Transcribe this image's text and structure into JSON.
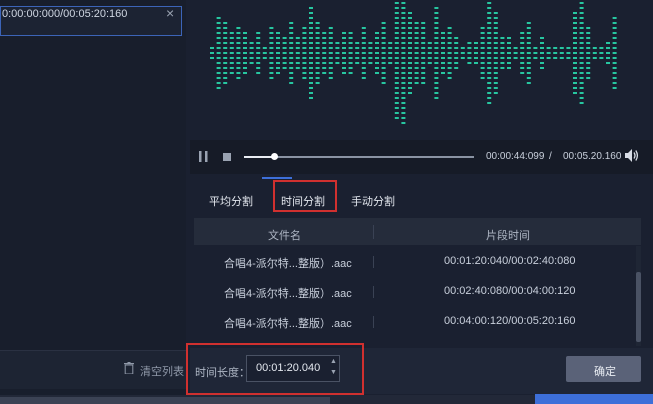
{
  "file_list": {
    "item_time": "0:00:00:000/00:05:20:160",
    "close_glyph": "×",
    "clear_label": "清空列表"
  },
  "player": {
    "current_time": "00:00:44:099",
    "separator": "/",
    "total_time": "00:05.20.160",
    "progress_fraction": 0.14
  },
  "tabs": [
    {
      "label": "平均分割"
    },
    {
      "label": "时间分割",
      "active": true
    },
    {
      "label": "手动分割"
    }
  ],
  "table": {
    "columns": [
      "文件名",
      "片段时间"
    ],
    "rows": [
      {
        "file": "合唱4-派尔特...整版）.aac",
        "segment": "00:01:20:040/00:02:40:080"
      },
      {
        "file": "合唱4-派尔特...整版）.aac",
        "segment": "00:02:40:080/00:04:00:120"
      },
      {
        "file": "合唱4-派尔特...整版）.aac",
        "segment": "00:04:00:120/00:05:20:160"
      }
    ]
  },
  "duration": {
    "label": "时间长度：",
    "value": "00:01:20.040"
  },
  "confirm_label": "确定",
  "colors": {
    "waveform": "#27c6a0",
    "highlight": "#d0302f",
    "accent": "#3d6fd9"
  }
}
